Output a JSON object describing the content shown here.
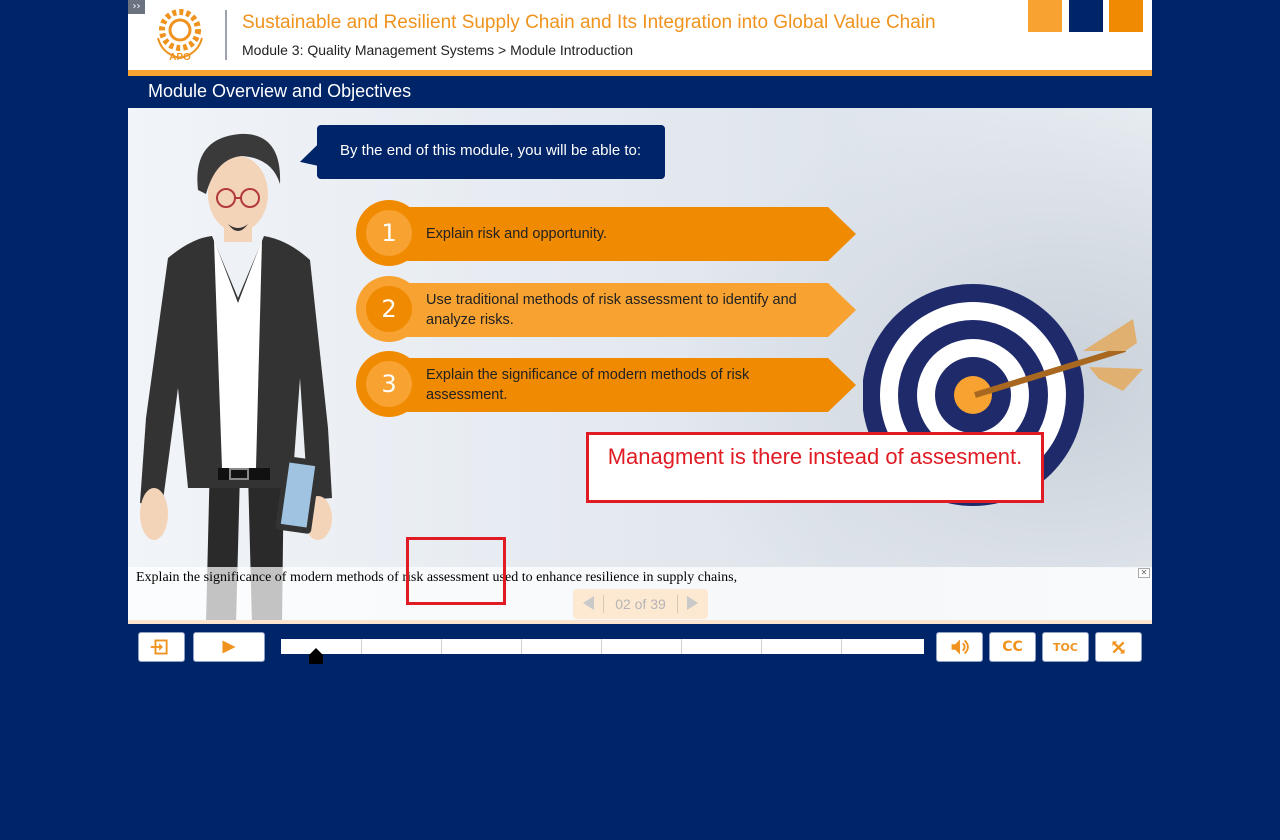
{
  "header": {
    "expand_glyph": "››",
    "logo_text": "APO",
    "course_title": "Sustainable and Resilient Supply Chain and Its Integration into Global Value Chain",
    "breadcrumb": "Module 3: Quality Management Systems > Module Introduction",
    "color_squares": [
      "#f7a231",
      "#002468",
      "#f08a00"
    ]
  },
  "section": {
    "title": "Module Overview and Objectives"
  },
  "slide": {
    "intro": "By the end of this module, you will be able to:",
    "objectives": [
      {
        "number": "1",
        "text": "Explain risk and opportunity."
      },
      {
        "number": "2",
        "text": "Use traditional methods of risk assessment to identify and analyze risks."
      },
      {
        "number": "3",
        "text": "Explain the significance of modern methods of risk assessment."
      }
    ],
    "annotation": "Managment is there instead of assesment.",
    "caption": "Explain the significance of modern methods of risk assessment used to enhance resilience in supply chains,",
    "caption_close": "✕",
    "pager": "02 of 39"
  },
  "controls": {
    "exit_icon": "exit-icon",
    "play_icon": "play-icon",
    "volume_icon": "volume-icon",
    "cc_label": "CC",
    "toc_label": "TOC",
    "fullscreen_icon": "fullscreen-icon",
    "progress_fraction": 0.055
  },
  "colors": {
    "navy": "#002468",
    "orange": "#f08a00",
    "light_orange": "#f7a231",
    "annotation_red": "#e01b24"
  }
}
